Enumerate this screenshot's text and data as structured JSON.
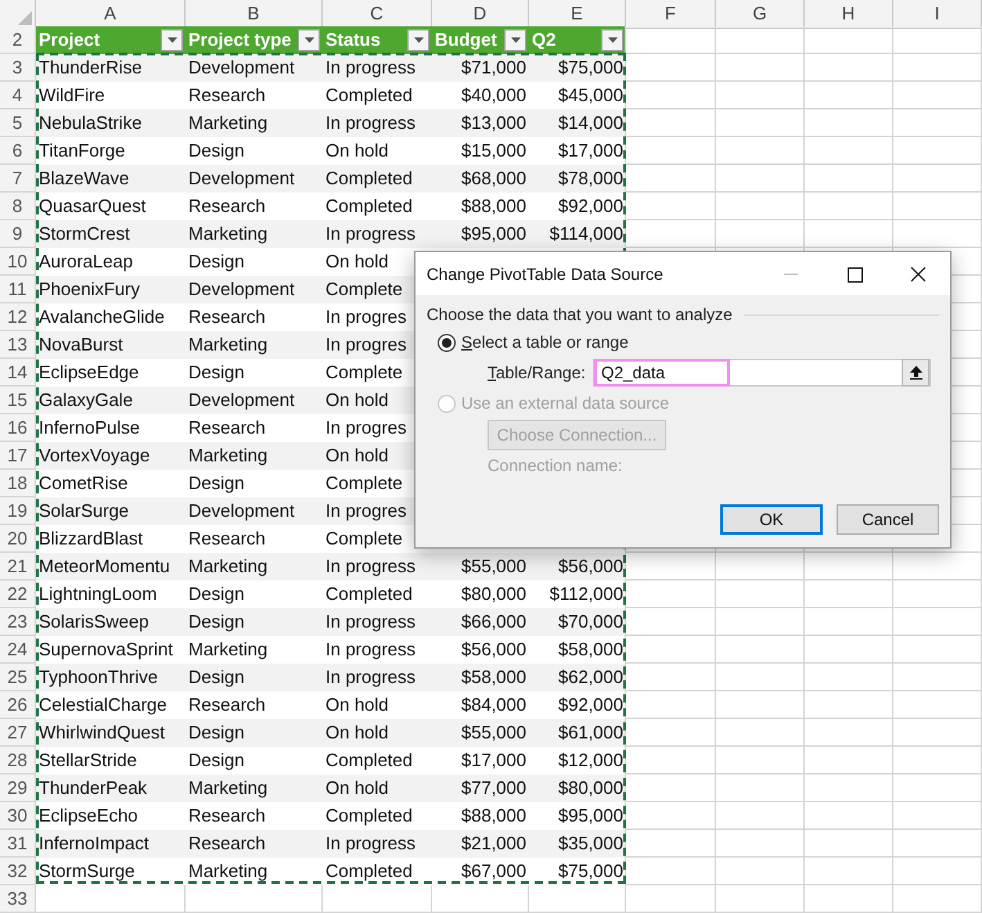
{
  "column_headers": [
    "A",
    "B",
    "C",
    "D",
    "E",
    "F",
    "G",
    "H",
    "I"
  ],
  "table": {
    "row_number": "2",
    "columns": [
      {
        "label": "Project"
      },
      {
        "label": "Project type"
      },
      {
        "label": "Status"
      },
      {
        "label": "Budget"
      },
      {
        "label": "Q2"
      }
    ],
    "rows": [
      {
        "number": "3",
        "cells": [
          "ThunderRise",
          "Development",
          "In progress",
          "$71,000",
          "$75,000"
        ]
      },
      {
        "number": "4",
        "cells": [
          "WildFire",
          "Research",
          "Completed",
          "$40,000",
          "$45,000"
        ]
      },
      {
        "number": "5",
        "cells": [
          "NebulaStrike",
          "Marketing",
          "In progress",
          "$13,000",
          "$14,000"
        ]
      },
      {
        "number": "6",
        "cells": [
          "TitanForge",
          "Design",
          "On hold",
          "$15,000",
          "$17,000"
        ]
      },
      {
        "number": "7",
        "cells": [
          "BlazeWave",
          "Development",
          "Completed",
          "$68,000",
          "$78,000"
        ]
      },
      {
        "number": "8",
        "cells": [
          "QuasarQuest",
          "Research",
          "Completed",
          "$88,000",
          "$92,000"
        ]
      },
      {
        "number": "9",
        "cells": [
          "StormCrest",
          "Marketing",
          "In progress",
          "$95,000",
          "$114,000"
        ]
      },
      {
        "number": "10",
        "cells": [
          "AuroraLeap",
          "Design",
          "On hold"
        ]
      },
      {
        "number": "11",
        "cells": [
          "PhoenixFury",
          "Development",
          "Complete"
        ]
      },
      {
        "number": "12",
        "cells": [
          "AvalancheGlide",
          "Research",
          "In progres"
        ]
      },
      {
        "number": "13",
        "cells": [
          "NovaBurst",
          "Marketing",
          "In progres"
        ]
      },
      {
        "number": "14",
        "cells": [
          "EclipseEdge",
          "Design",
          "Complete"
        ]
      },
      {
        "number": "15",
        "cells": [
          "GalaxyGale",
          "Development",
          "On hold"
        ]
      },
      {
        "number": "16",
        "cells": [
          "InfernoPulse",
          "Research",
          "In progres"
        ]
      },
      {
        "number": "17",
        "cells": [
          "VortexVoyage",
          "Marketing",
          "On hold"
        ]
      },
      {
        "number": "18",
        "cells": [
          "CometRise",
          "Design",
          "Complete"
        ]
      },
      {
        "number": "19",
        "cells": [
          "SolarSurge",
          "Development",
          "In progres"
        ]
      },
      {
        "number": "20",
        "cells": [
          "BlizzardBlast",
          "Research",
          "Complete"
        ]
      },
      {
        "number": "21",
        "cells": [
          "MeteorMomentu",
          "Marketing",
          "In progress",
          "$55,000",
          "$56,000"
        ]
      },
      {
        "number": "22",
        "cells": [
          "LightningLoom",
          "Design",
          "Completed",
          "$80,000",
          "$112,000"
        ]
      },
      {
        "number": "23",
        "cells": [
          "SolarisSweep",
          "Design",
          "In progress",
          "$66,000",
          "$70,000"
        ]
      },
      {
        "number": "24",
        "cells": [
          "SupernovaSprint",
          "Marketing",
          "In progress",
          "$56,000",
          "$58,000"
        ]
      },
      {
        "number": "25",
        "cells": [
          "TyphoonThrive",
          "Design",
          "In progress",
          "$58,000",
          "$62,000"
        ]
      },
      {
        "number": "26",
        "cells": [
          "CelestialCharge",
          "Research",
          "On hold",
          "$84,000",
          "$92,000"
        ]
      },
      {
        "number": "27",
        "cells": [
          "WhirlwindQuest",
          "Design",
          "On hold",
          "$55,000",
          "$61,000"
        ]
      },
      {
        "number": "28",
        "cells": [
          "StellarStride",
          "Design",
          "Completed",
          "$17,000",
          "$12,000"
        ]
      },
      {
        "number": "29",
        "cells": [
          "ThunderPeak",
          "Marketing",
          "On hold",
          "$77,000",
          "$80,000"
        ]
      },
      {
        "number": "30",
        "cells": [
          "EclipseEcho",
          "Research",
          "Completed",
          "$88,000",
          "$95,000"
        ]
      },
      {
        "number": "31",
        "cells": [
          "InfernoImpact",
          "Research",
          "In progress",
          "$21,000",
          "$35,000"
        ]
      },
      {
        "number": "32",
        "cells": [
          "StormSurge",
          "Marketing",
          "Completed",
          "$67,000",
          "$75,000"
        ]
      }
    ]
  },
  "empty_rows": [
    "33"
  ],
  "dialog": {
    "title": "Change PivotTable Data Source",
    "group_label": "Choose the data that you want to analyze",
    "options": [
      {
        "kind": "radio",
        "label": "Select a table or range",
        "selected": true,
        "disabled": false,
        "access_key": true
      },
      {
        "kind": "radio",
        "label": "Use an external data source",
        "selected": false,
        "disabled": true
      }
    ],
    "range_field": {
      "label": "Table/Range:",
      "access_key": true,
      "value": "Q2_data",
      "highlighted": true
    },
    "connection_button": {
      "label": "Choose Connection...",
      "disabled": true
    },
    "connection_name": {
      "label": "Connection name:",
      "disabled": true
    },
    "buttons": [
      {
        "label": "OK",
        "default": true
      },
      {
        "label": "Cancel",
        "default": false
      }
    ]
  }
}
